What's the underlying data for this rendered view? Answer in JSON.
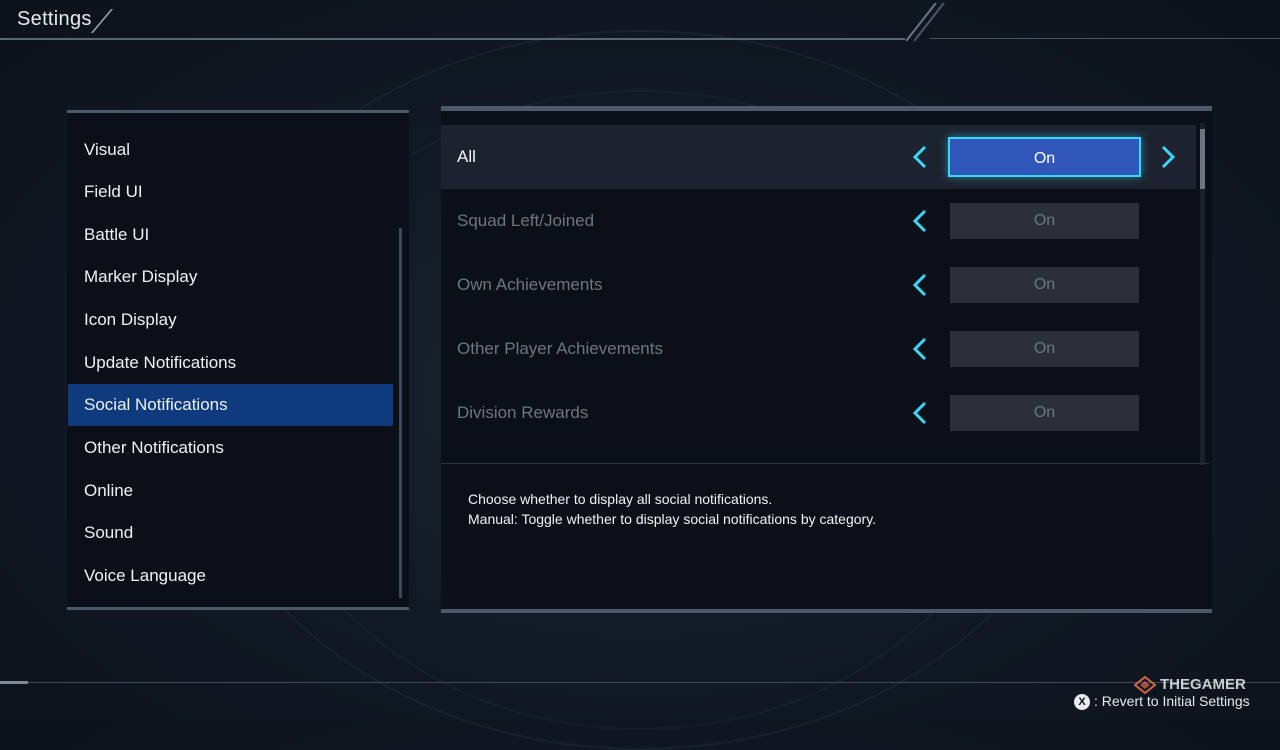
{
  "header": {
    "title": "Settings"
  },
  "sidebar": {
    "items": [
      {
        "label": "Visual"
      },
      {
        "label": "Field UI"
      },
      {
        "label": "Battle UI"
      },
      {
        "label": "Marker Display"
      },
      {
        "label": "Icon Display"
      },
      {
        "label": "Update Notifications"
      },
      {
        "label": "Social Notifications",
        "selected": true
      },
      {
        "label": "Other Notifications"
      },
      {
        "label": "Online"
      },
      {
        "label": "Sound"
      },
      {
        "label": "Voice Language"
      }
    ]
  },
  "settings": {
    "rows": [
      {
        "label": "All",
        "value": "On",
        "active": true
      },
      {
        "label": "Squad Left/Joined",
        "value": "On"
      },
      {
        "label": "Own Achievements",
        "value": "On"
      },
      {
        "label": "Other Player Achievements",
        "value": "On"
      },
      {
        "label": "Division Rewards",
        "value": "On"
      }
    ]
  },
  "description": {
    "line1": "Choose whether to display all social notifications.",
    "line2": "Manual: Toggle whether to display social notifications by category."
  },
  "footer": {
    "button_icon": "X",
    "action_label": ": Revert to Initial Settings"
  },
  "watermark": {
    "text": "THEGAMER"
  },
  "colors": {
    "accent": "#39d6ff",
    "selected_bg": "#0f3b7e",
    "active_value_bg": "#2f56b8"
  }
}
